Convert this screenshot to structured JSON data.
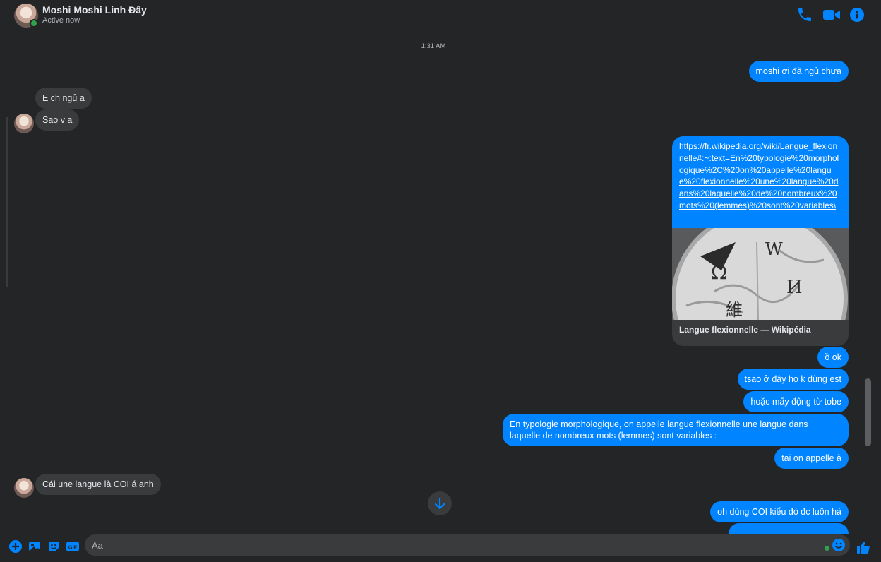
{
  "header": {
    "contact_name": "Moshi Moshi Linh Đây",
    "status": "Active now"
  },
  "chat": {
    "timestamp": "1:31 AM",
    "messages": [
      {
        "dir": "out",
        "text": "moshi ơi đã ngủ chưa"
      },
      {
        "dir": "in",
        "text": "E ch ngủ a"
      },
      {
        "dir": "in",
        "text": "Sao v a"
      },
      {
        "dir": "out",
        "text": "ồ ok"
      },
      {
        "dir": "out",
        "text": "tsao ở đây họ k dùng est"
      },
      {
        "dir": "out",
        "text": "hoặc mấy động từ tobe"
      },
      {
        "dir": "out",
        "text_line1": "En typologie morphologique, on appelle langue flexionnelle une langue dans",
        "text_line2": "laquelle de nombreux mots (lemmes) sont variables :"
      },
      {
        "dir": "out",
        "text": "tại on appelle à"
      },
      {
        "dir": "in",
        "text": "Cái une langue là COI á anh"
      },
      {
        "dir": "out",
        "text": "oh dùng COI kiểu đó đc luôn hả"
      }
    ],
    "link_preview": {
      "url": "https://fr.wikipedia.org/wiki/Langue_flexionnelle#:~:text=En%20typologie%20morphologique%2C%20on%20appelle%20langue%20flexionnelle%20une%20langue%20dans%20laquelle%20de%20nombreux%20mots%20(lemmes)%20sont%20variables\\",
      "title": "Langue flexionnelle — Wikipédia",
      "globe_glyphs": [
        "Ω",
        "W",
        "И",
        "維"
      ]
    }
  },
  "composer": {
    "placeholder": "Aa"
  },
  "colors": {
    "accent": "#0084ff",
    "background": "#242526",
    "incoming_bubble": "#3a3b3c",
    "online": "#31a24c"
  },
  "icons": [
    "phone-icon",
    "video-camera-icon",
    "info-icon",
    "plus-circle-icon",
    "image-icon",
    "sticker-icon",
    "gif-icon",
    "emoji-icon",
    "thumbs-up-icon",
    "arrow-down-icon"
  ]
}
